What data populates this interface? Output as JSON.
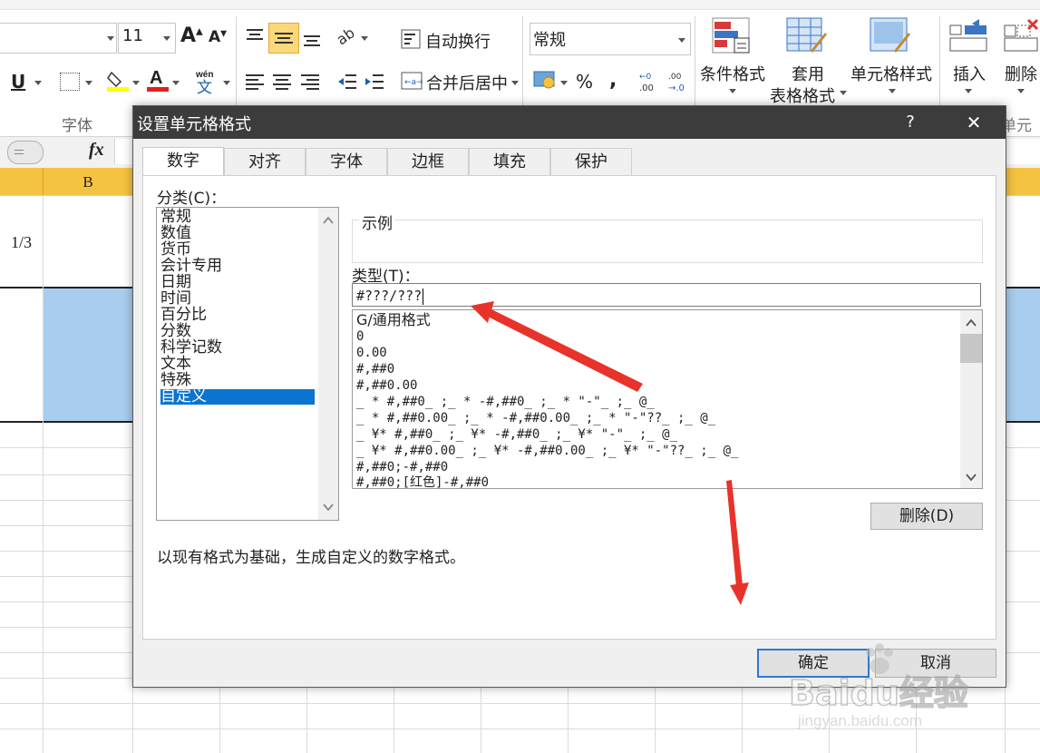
{
  "ribbon": {
    "font_size": "11",
    "underline": "U",
    "wrap_text": "自动换行",
    "merge_center": "合并后居中",
    "number_format": "常规",
    "percent": "%",
    "comma": ",",
    "conditional_format": "条件格式",
    "table_format_line1": "套用",
    "table_format_line2": "表格格式",
    "cell_styles": "单元格样式",
    "insert": "插入",
    "delete": "删除",
    "group_font": "字体",
    "group_cells_partial": "单元格"
  },
  "formula_bar": {
    "fx": "fx"
  },
  "sheet": {
    "column_b": "B",
    "cell_value": "1/3"
  },
  "dialog": {
    "title": "设置单元格格式",
    "help": "?",
    "close": "✕",
    "tabs": [
      "数字",
      "对齐",
      "字体",
      "边框",
      "填充",
      "保护"
    ],
    "category_label": "分类(C)：",
    "categories": [
      "常规",
      "数值",
      "货币",
      "会计专用",
      "日期",
      "时间",
      "百分比",
      "分数",
      "科学记数",
      "文本",
      "特殊",
      "自定义"
    ],
    "sample_label": "示例",
    "type_label": "类型(T)：",
    "type_value": "#???/???",
    "formats": [
      "G/通用格式",
      "0",
      "0.00",
      "#,##0",
      "#,##0.00",
      "_ * #,##0_ ;_ * -#,##0_ ;_ * \"-\"_ ;_ @_",
      "_ * #,##0.00_ ;_ * -#,##0.00_ ;_ * \"-\"??_ ;_ @_",
      "_ ¥* #,##0_ ;_ ¥* -#,##0_ ;_ ¥* \"-\"_ ;_ @_",
      "_ ¥* #,##0.00_ ;_ ¥* -#,##0.00_ ;_ ¥* \"-\"??_ ;_ @_",
      "#,##0;-#,##0",
      "#,##0;[红色]-#,##0"
    ],
    "delete_button": "删除(D)",
    "description": "以现有格式为基础，生成自定义的数字格式。",
    "ok_button": "确定",
    "cancel_button": "取消"
  },
  "watermark": {
    "brand": "Baidu经验",
    "url": "jingyan.baidu.com"
  },
  "colors": {
    "selection_blue": "#0a74d0",
    "cell_highlight": "#a9cdee",
    "column_header_highlight": "#f5c342",
    "arrow_red": "#e8332a",
    "dialog_titlebar": "#3c3c3c"
  }
}
